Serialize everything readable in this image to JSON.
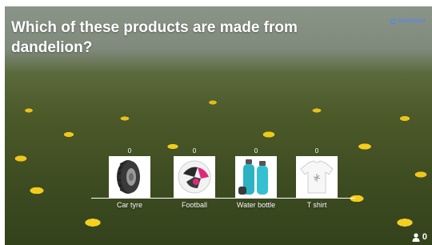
{
  "question": {
    "title": "Which of these products are made from dandelion?"
  },
  "brand": {
    "name": "Mentimeter",
    "icon": "mentimeter-logo-icon"
  },
  "colors": {
    "brand": "#4b86ff",
    "text": "#ffffff"
  },
  "chart_data": {
    "type": "bar",
    "categories": [
      "Car tyre",
      "Football",
      "Water bottle",
      "T shirt"
    ],
    "values": [
      0,
      0,
      0,
      0
    ]
  },
  "options": [
    {
      "label": "Car tyre",
      "count": "0",
      "image": "car-tyre-image"
    },
    {
      "label": "Football",
      "count": "0",
      "image": "football-image"
    },
    {
      "label": "Water bottle",
      "count": "0",
      "image": "water-bottle-image"
    },
    {
      "label": "T shirt",
      "count": "0",
      "image": "t-shirt-image"
    }
  ],
  "participants": {
    "count": "0",
    "icon": "person-icon"
  }
}
